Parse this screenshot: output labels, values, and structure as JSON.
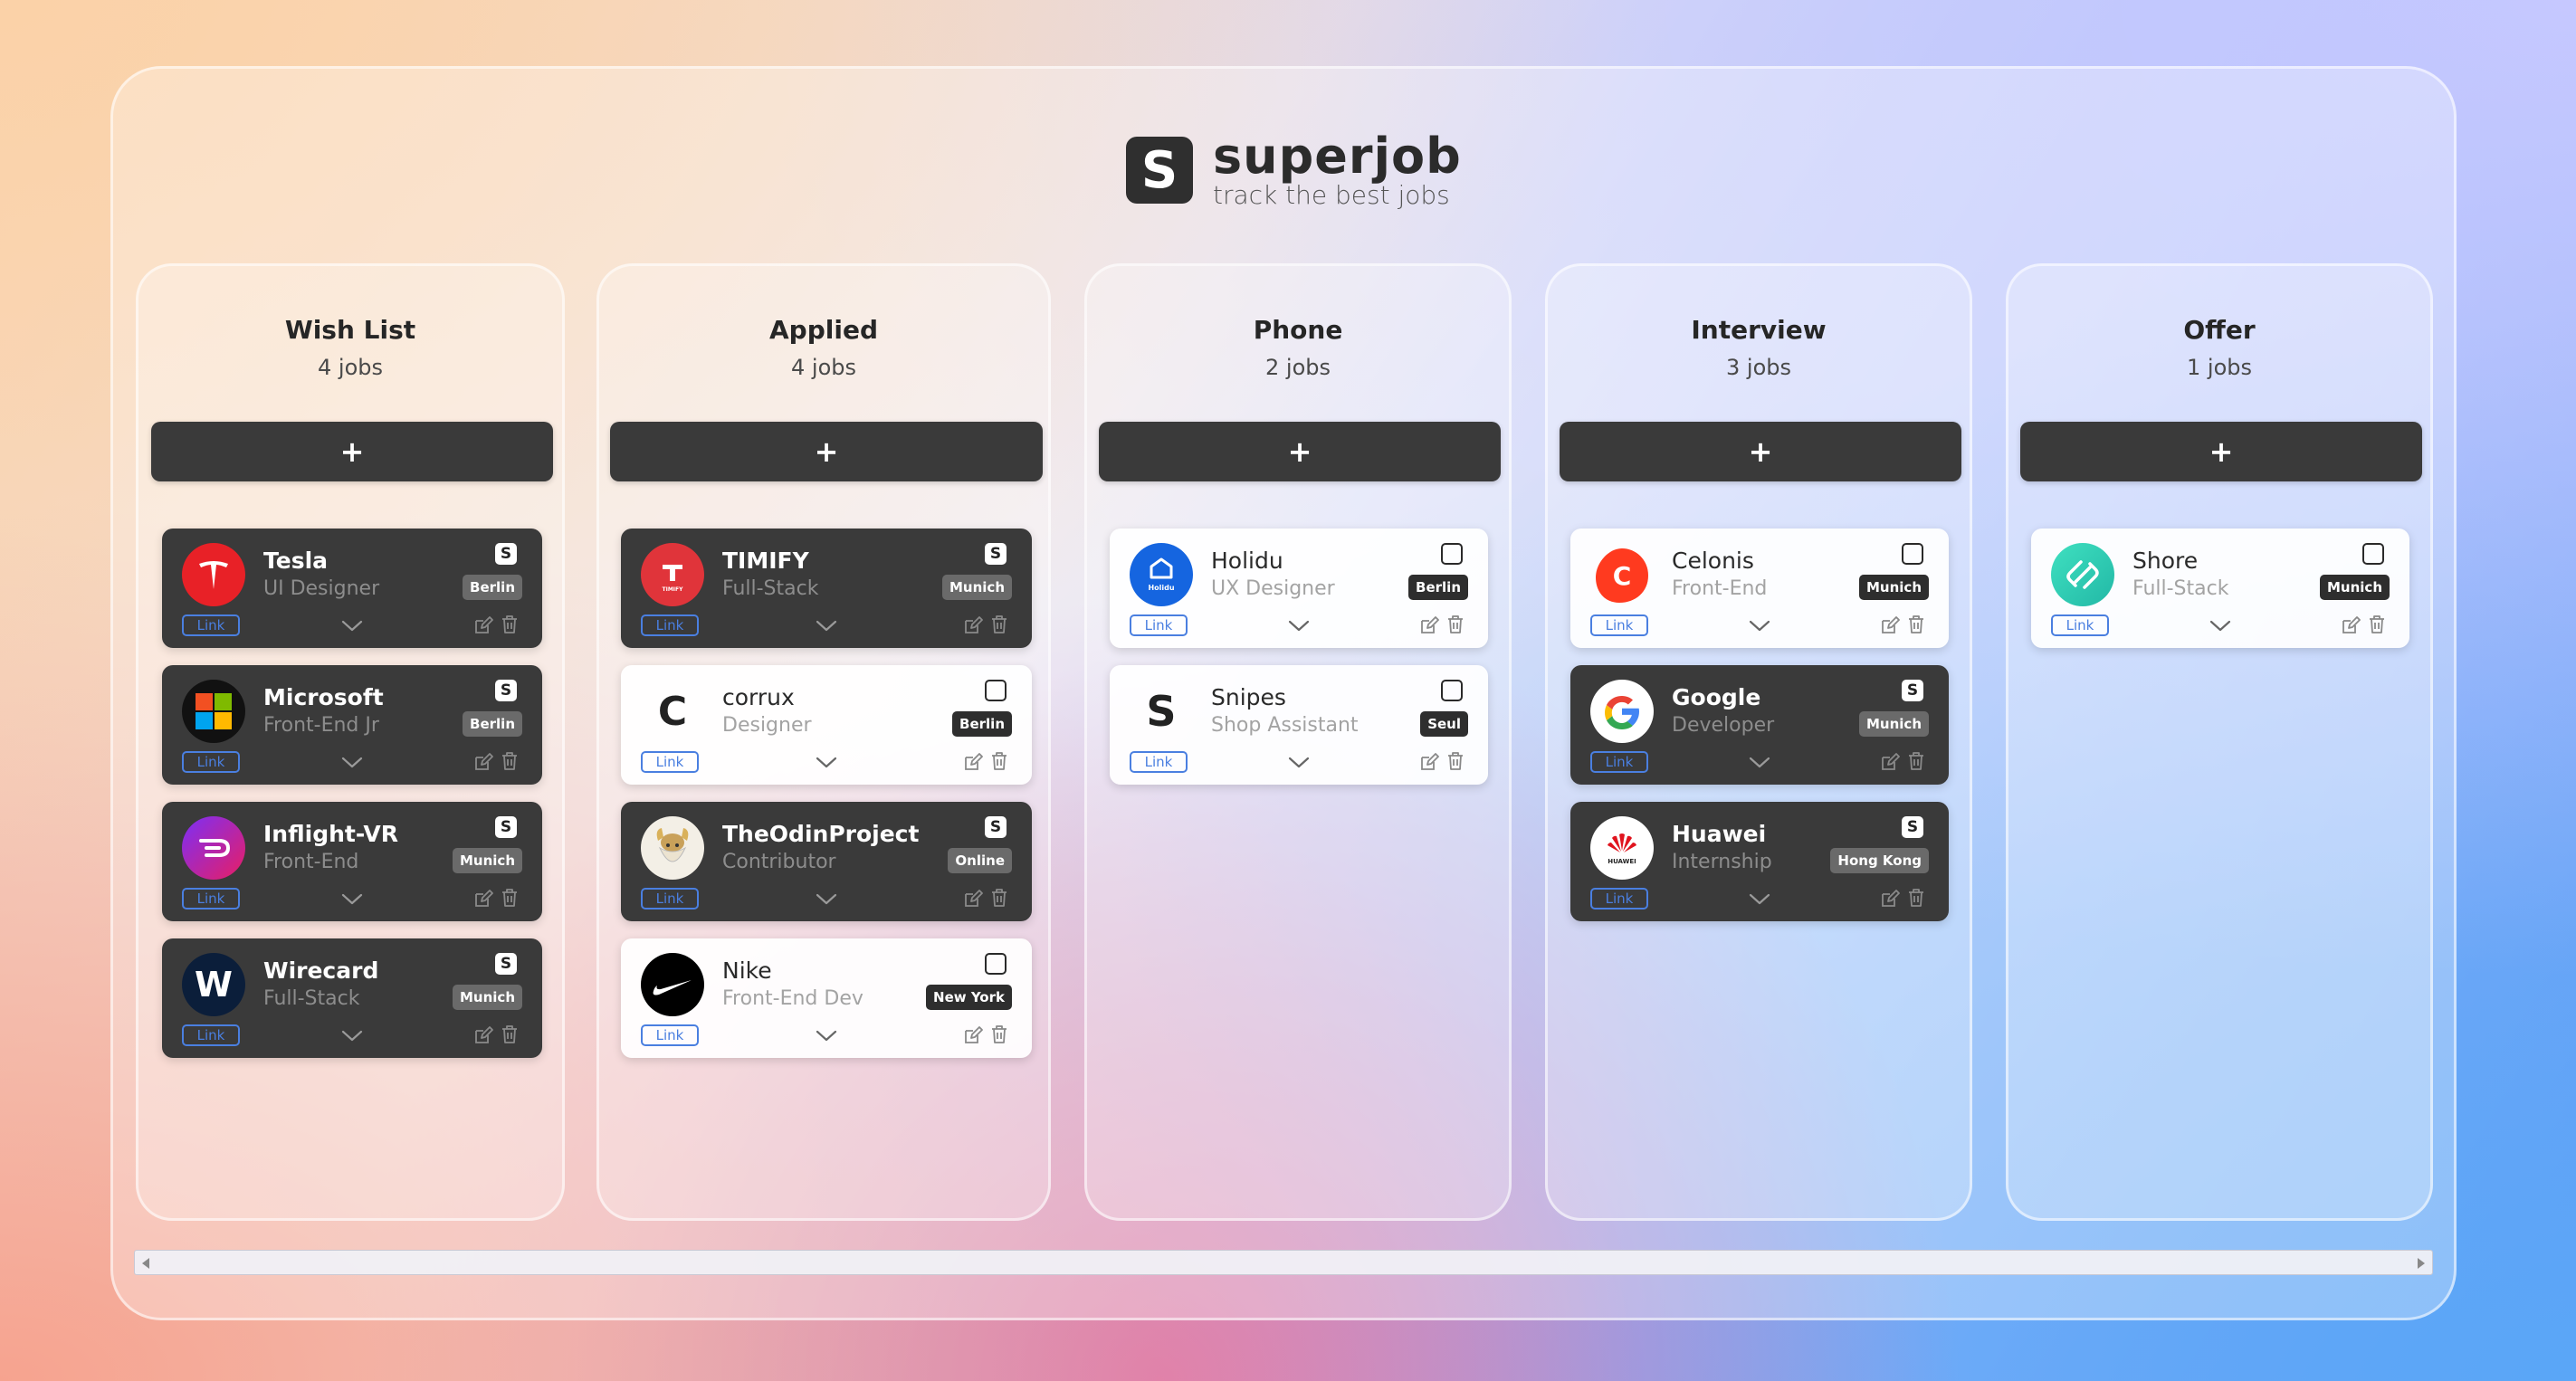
{
  "app": {
    "name": "superjob",
    "tagline": "track the best jobs",
    "logo_letter": "S"
  },
  "columns": [
    {
      "title": "Wish List",
      "count": "4 jobs",
      "add_label": "+",
      "cards": [
        {
          "company": "Tesla",
          "role": "UI Designer",
          "location": "Berlin",
          "link": "Link",
          "theme": "dark",
          "logo": "tesla-logo"
        },
        {
          "company": "Microsoft",
          "role": "Front-End Jr",
          "location": "Berlin",
          "link": "Link",
          "theme": "dark",
          "logo": "microsoft-logo"
        },
        {
          "company": "Inflight-VR",
          "role": "Front-End",
          "location": "Munich",
          "link": "Link",
          "theme": "dark",
          "logo": "inflight-vr-logo"
        },
        {
          "company": "Wirecard",
          "role": "Full-Stack",
          "location": "Munich",
          "link": "Link",
          "theme": "dark",
          "logo": "wirecard-logo"
        }
      ]
    },
    {
      "title": "Applied",
      "count": "4 jobs",
      "add_label": "+",
      "cards": [
        {
          "company": "TIMIFY",
          "role": "Full-Stack",
          "location": "Munich",
          "link": "Link",
          "theme": "dark",
          "logo": "timify-logo"
        },
        {
          "company": "corrux",
          "role": "Designer",
          "location": "Berlin",
          "link": "Link",
          "theme": "light",
          "logo": "corrux-logo"
        },
        {
          "company": "TheOdinProject",
          "role": "Contributor",
          "location": "Online",
          "link": "Link",
          "theme": "dark",
          "logo": "odin-project-logo"
        },
        {
          "company": "Nike",
          "role": "Front-End Dev",
          "location": "New York",
          "link": "Link",
          "theme": "light",
          "logo": "nike-logo"
        }
      ]
    },
    {
      "title": "Phone",
      "count": "2 jobs",
      "add_label": "+",
      "cards": [
        {
          "company": "Holidu",
          "role": "UX Designer",
          "location": "Berlin",
          "link": "Link",
          "theme": "light",
          "logo": "holidu-logo"
        },
        {
          "company": "Snipes",
          "role": "Shop Assistant",
          "location": "Seul",
          "link": "Link",
          "theme": "light",
          "logo": "snipes-logo"
        }
      ]
    },
    {
      "title": "Interview",
      "count": "3 jobs",
      "add_label": "+",
      "cards": [
        {
          "company": "Celonis",
          "role": "Front-End",
          "location": "Munich",
          "link": "Link",
          "theme": "light",
          "logo": "celonis-logo"
        },
        {
          "company": "Google",
          "role": "Developer",
          "location": "Munich",
          "link": "Link",
          "theme": "dark",
          "logo": "google-logo"
        },
        {
          "company": "Huawei",
          "role": "Internship",
          "location": "Hong Kong",
          "link": "Link",
          "theme": "dark",
          "logo": "huawei-logo"
        }
      ]
    },
    {
      "title": "Offer",
      "count": "1 jobs",
      "add_label": "+",
      "cards": [
        {
          "company": "Shore",
          "role": "Full-Stack",
          "location": "Munich",
          "link": "Link",
          "theme": "light",
          "logo": "shore-logo"
        }
      ]
    }
  ],
  "logo_texts": {
    "timify": "TIMIFY",
    "holidu": "Holidu",
    "huawei": "HUAWEI",
    "corrux": "C",
    "snipes": "S",
    "wirecard": "W",
    "celonis": "C"
  },
  "flag_letter": "S",
  "colors": {
    "dark_card": "#3a3a3a",
    "link_blue": "#4a7fe0",
    "add_button": "#3a3a3a"
  }
}
